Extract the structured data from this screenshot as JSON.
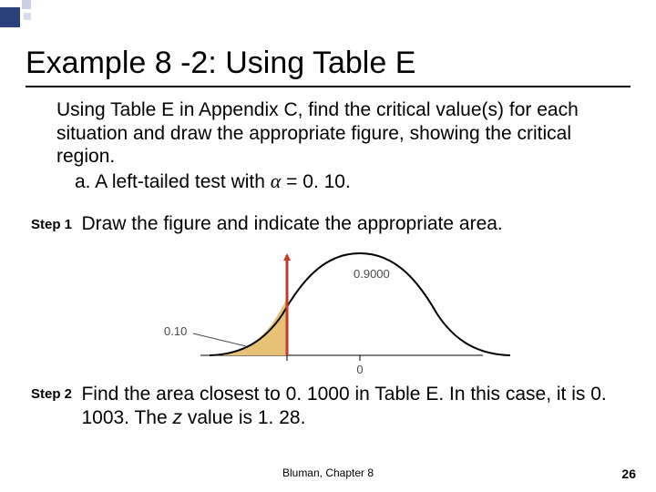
{
  "title": "Example 8 -2: Using Table E",
  "intro": "Using Table E in Appendix C, find the critical value(s) for each situation and draw the appropriate figure, showing the critical region.",
  "part_a_prefix": "a. A left-tailed test with ",
  "part_a_alpha": "α",
  "part_a_suffix": " = 0. 10.",
  "step1": {
    "label": "Step 1",
    "text": "Draw the figure and indicate the appropriate area."
  },
  "figure": {
    "left_area_label": "0.10",
    "right_area_label": "0.9000",
    "axis_zero": "0"
  },
  "step2": {
    "label": "Step 2",
    "text_pre": "Find the area closest to 0. 1000 in Table E. In this case, it is 0. 1003. The ",
    "z_label": "z",
    "text_post": " value is 1. 28."
  },
  "footer": "Bluman, Chapter 8",
  "page_number": "26",
  "chart_data": {
    "type": "area",
    "title": "Normal distribution with left-tail critical region",
    "critical_value_marker": 0,
    "shaded_region": "left_tail",
    "alpha": 0.1,
    "remaining_area": 0.9,
    "z_critical_approx": -1.28,
    "axis_tick": 0
  }
}
